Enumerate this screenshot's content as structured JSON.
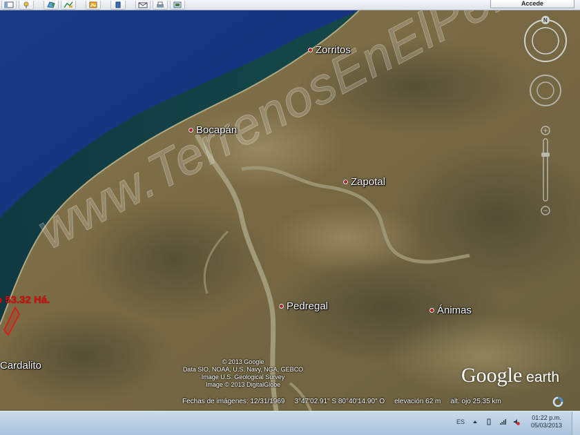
{
  "toolbar": {
    "buttons": [
      "hide-sidebar",
      "placemark",
      "polygon",
      "path",
      "overlay",
      "tour",
      "planets",
      "ruler",
      "email",
      "print",
      "save-image"
    ],
    "signin_label": "Accede"
  },
  "map": {
    "places": [
      {
        "id": "zorritos",
        "label": "Zorritos"
      },
      {
        "id": "bocapan",
        "label": "Bocapán"
      },
      {
        "id": "zapotal",
        "label": "Zapotal"
      },
      {
        "id": "pedregal",
        "label": "Pedregal"
      },
      {
        "id": "animas",
        "label": "Ánimas"
      },
      {
        "id": "cardalito",
        "label": "Cardalito"
      }
    ],
    "parcel_label": "o 53.32 Há.",
    "watermark": "www.TerrenosEnElPeru.com",
    "credits": [
      "© 2013 Google",
      "Data SIO, NOAA, U.S. Navy, NGA, GEBCO",
      "Image U.S. Geological Survey",
      "Image © 2013 DigitalGlobe"
    ],
    "logo": {
      "part1": "Google",
      "part2": " earth"
    },
    "status": {
      "imagery_date": "Fechas de imágenes: 12/31/1969",
      "coordinates": "3°47'02.91\" S   80°40'14.90\" O",
      "elevation": "elevación    62 m",
      "eye_altitude": "alt. ojo  25.35 km"
    },
    "colors": {
      "sea_deep": "#15306e",
      "sea_coast": "#0f4a3c",
      "land": "#7d7048",
      "place_dot": "#b3202b",
      "parcel": "#d80d0d"
    }
  },
  "taskbar": {
    "language": "ES",
    "time": "01:22 p.m.",
    "date": "05/03/2013"
  }
}
